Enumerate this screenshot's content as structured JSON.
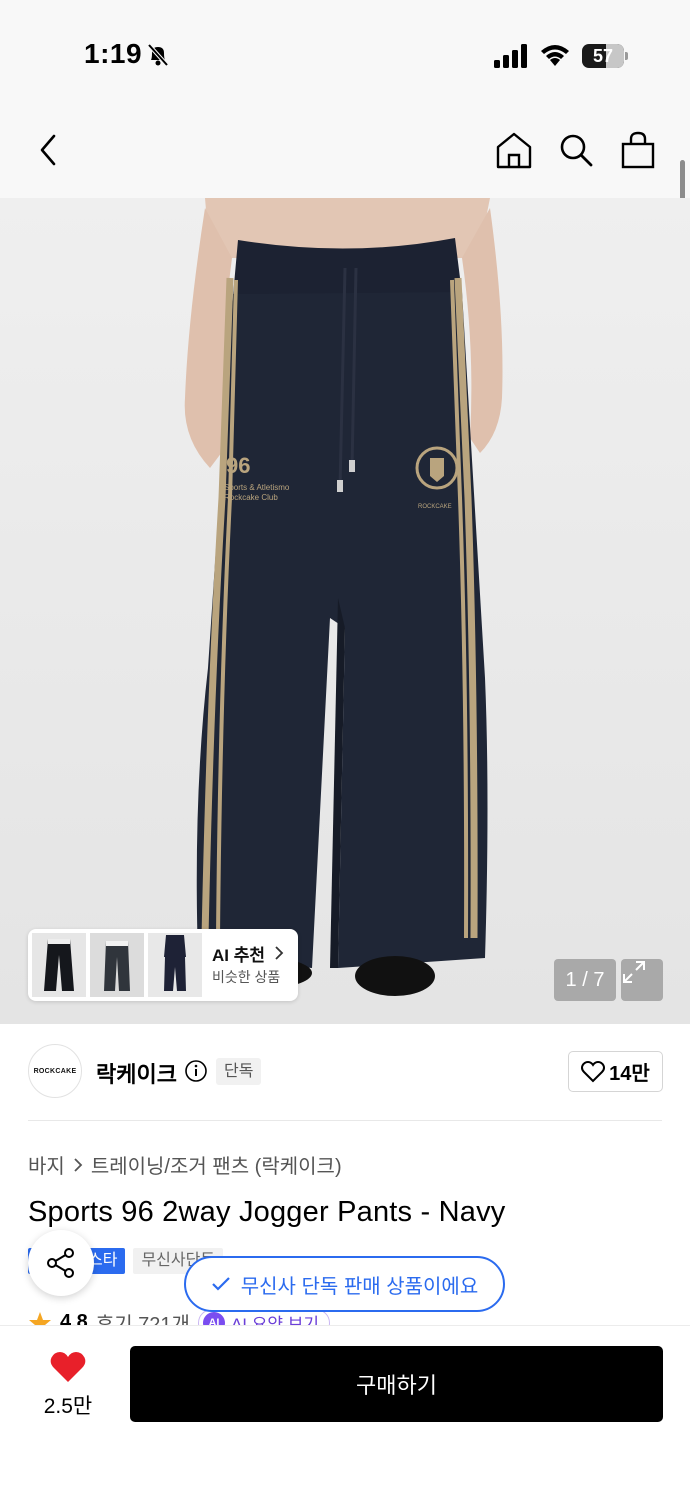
{
  "status_bar": {
    "time": "1:19",
    "battery_level": "57",
    "battery_percent": 57
  },
  "header": {
    "back_icon": "chevron-left-icon",
    "home_icon": "home-icon",
    "search_icon": "search-icon",
    "bag_icon": "shopping-bag-icon"
  },
  "gallery": {
    "counter": "1 / 7",
    "ai_recommend": {
      "title": "AI 추천",
      "subtitle": "비슷한 상품"
    }
  },
  "brand": {
    "logo_text": "ROCKCAKE",
    "name": "락케이크",
    "tag": "단독",
    "like_count": "14만"
  },
  "product": {
    "breadcrumb": [
      "바지",
      "트레이닝/조거 팬츠 (락케이크)"
    ],
    "title": "Sports 96 2way Jogger Pants - Navy",
    "badges": [
      "스타",
      "무신사단독"
    ],
    "toast": "무신사 단독 판매 상품이에요",
    "rating": "4.8",
    "reviews": "후기 721개",
    "ai_summary": "AI 요약 보기",
    "ai_badge": "AI"
  },
  "bottom_bar": {
    "like_count": "2.5만",
    "buy_label": "구매하기"
  },
  "colors": {
    "accent_blue": "#2b6bef",
    "heart_red": "#e8202a",
    "navy_pants": "#1f2636",
    "stripe_tan": "#b9a47e"
  }
}
